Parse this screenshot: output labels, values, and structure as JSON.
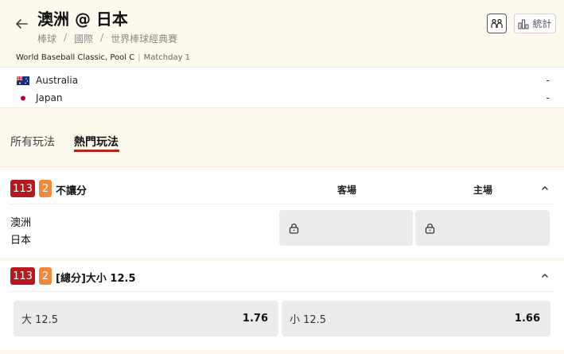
{
  "header": {
    "title": "澳洲 @ 日本",
    "breadcrumb": [
      "棒球",
      "國際",
      "世界棒球經典賽"
    ],
    "stats_label": "統計"
  },
  "match": {
    "competition": "World Baseball Classic, Pool C",
    "matchday": "Matchday 1",
    "teams": [
      {
        "name": "Australia",
        "score": "-"
      },
      {
        "name": "Japan",
        "score": "-"
      }
    ]
  },
  "tabs": [
    {
      "label": "所有玩法",
      "active": false
    },
    {
      "label": "熱門玩法",
      "active": true
    }
  ],
  "markets": [
    {
      "badge_id": "113",
      "badge_num": "2",
      "title": "不讓分",
      "col_away": "客場",
      "col_home": "主場",
      "team_lines": [
        "澳洲",
        "日本"
      ]
    },
    {
      "badge_id": "113",
      "badge_num": "2",
      "title": "[總分]大小 12.5",
      "options": [
        {
          "label": "大 12.5",
          "odds": "1.76"
        },
        {
          "label": "小 12.5",
          "odds": "1.66"
        }
      ]
    }
  ],
  "colors": {
    "accent": "#b3261e",
    "badge_red": "#b3191f",
    "badge_orange": "#f0893a",
    "background": "#fdf9ec"
  }
}
